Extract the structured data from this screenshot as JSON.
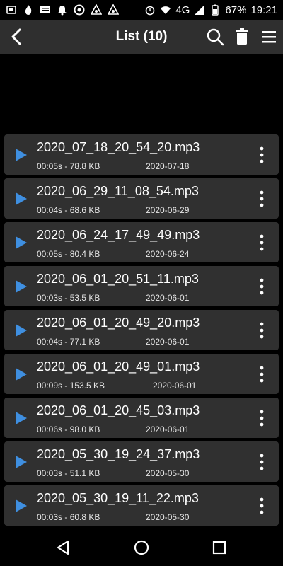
{
  "status_bar": {
    "battery": "67%",
    "time": "19:21",
    "network": "4G",
    "icons": [
      "notification-icon",
      "flame-icon",
      "news-icon",
      "bell-icon",
      "app-icon",
      "vpn-icon",
      "vpn-icon",
      "alarm-icon",
      "wifi-icon",
      "signal-icon",
      "battery-icon"
    ]
  },
  "app_bar": {
    "title": "List (10)",
    "back_icon": "back-arrow-icon",
    "actions": [
      "search-icon",
      "trash-icon",
      "menu-icon"
    ]
  },
  "recordings": [
    {
      "name": "2020_07_18_20_54_20.mp3",
      "meta": "00:05s - 78.8 KB",
      "date": "2020-07-18"
    },
    {
      "name": "2020_06_29_11_08_54.mp3",
      "meta": "00:04s - 68.6 KB",
      "date": "2020-06-29"
    },
    {
      "name": "2020_06_24_17_49_49.mp3",
      "meta": "00:05s - 80.4 KB",
      "date": "2020-06-24"
    },
    {
      "name": "2020_06_01_20_51_11.mp3",
      "meta": "00:03s - 53.5 KB",
      "date": "2020-06-01"
    },
    {
      "name": "2020_06_01_20_49_20.mp3",
      "meta": "00:04s - 77.1 KB",
      "date": "2020-06-01"
    },
    {
      "name": "2020_06_01_20_49_01.mp3",
      "meta": "00:09s - 153.5 KB",
      "date": "2020-06-01"
    },
    {
      "name": "2020_06_01_20_45_03.mp3",
      "meta": "00:06s - 98.0 KB",
      "date": "2020-06-01"
    },
    {
      "name": "2020_05_30_19_24_37.mp3",
      "meta": "00:03s - 51.1 KB",
      "date": "2020-05-30"
    },
    {
      "name": "2020_05_30_19_11_22.mp3",
      "meta": "00:03s - 60.8 KB",
      "date": "2020-05-30"
    }
  ],
  "colors": {
    "play_accent": "#3f8fe0",
    "card_bg": "#303030",
    "appbar_bg": "#2f2f2f"
  }
}
